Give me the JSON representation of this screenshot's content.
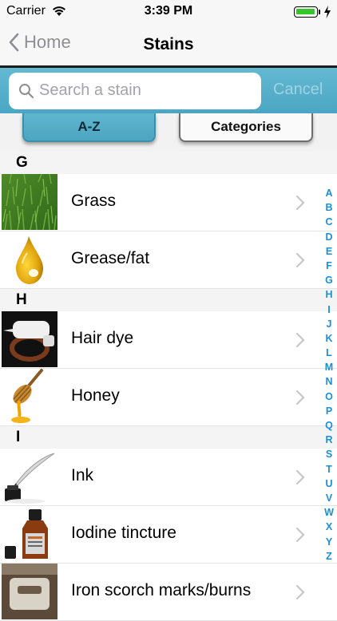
{
  "status": {
    "carrier": "Carrier",
    "time": "3:39 PM"
  },
  "nav": {
    "back_label": "Home",
    "title": "Stains"
  },
  "search": {
    "placeholder": "Search a stain",
    "cancel_label": "Cancel"
  },
  "segments": {
    "az": "A-Z",
    "categories": "Categories",
    "selected": "A-Z"
  },
  "sections": [
    {
      "letter": "G",
      "items": [
        {
          "label": "Grass",
          "icon": "grass-thumbnail"
        },
        {
          "label": "Grease/fat",
          "icon": "oil-drop-thumbnail"
        }
      ]
    },
    {
      "letter": "H",
      "items": [
        {
          "label": "Hair dye",
          "icon": "hair-dye-bottle-thumbnail"
        },
        {
          "label": "Honey",
          "icon": "honey-dipper-thumbnail"
        }
      ]
    },
    {
      "letter": "I",
      "items": [
        {
          "label": "Ink",
          "icon": "inkwell-quill-thumbnail"
        },
        {
          "label": "Iodine tincture",
          "icon": "iodine-bottle-thumbnail"
        },
        {
          "label": "Iron scorch marks/burns",
          "icon": "iron-thumbnail"
        }
      ]
    }
  ],
  "index_letters": [
    "A",
    "B",
    "C",
    "D",
    "E",
    "F",
    "G",
    "H",
    "I",
    "J",
    "K",
    "L",
    "M",
    "N",
    "O",
    "P",
    "Q",
    "R",
    "S",
    "T",
    "U",
    "V",
    "W",
    "X",
    "Y",
    "Z"
  ],
  "colors": {
    "accent": "#4aa6c3",
    "index": "#1a8fd6",
    "battery": "#36c52b"
  }
}
